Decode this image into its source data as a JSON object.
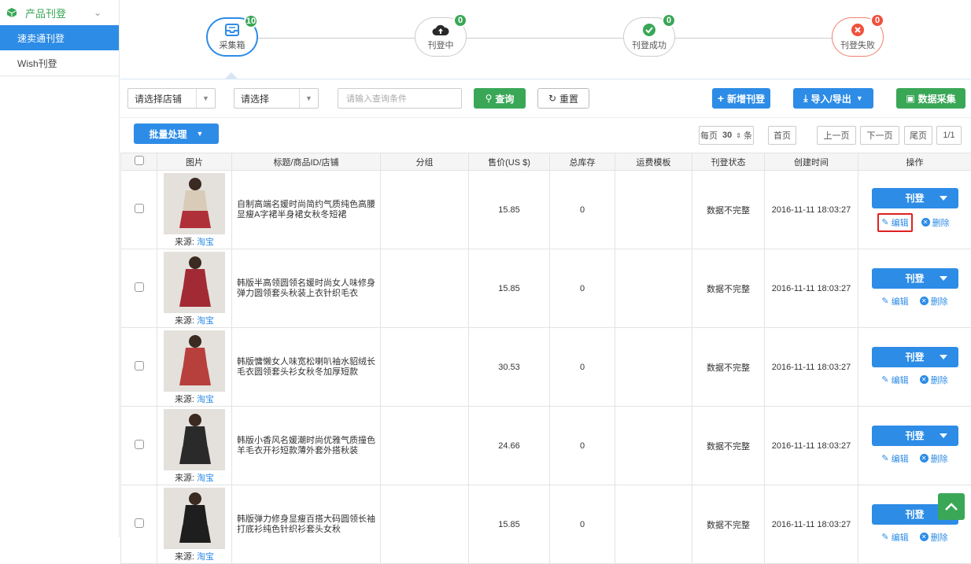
{
  "sidebar": {
    "header": "产品刊登",
    "items": [
      {
        "label": "速卖通刊登",
        "active": true
      },
      {
        "label": "Wish刊登",
        "active": false
      }
    ]
  },
  "steps": [
    {
      "label": "采集箱",
      "count": "10",
      "icon": "inbox-icon"
    },
    {
      "label": "刊登中",
      "count": "0",
      "icon": "cloud-upload-icon"
    },
    {
      "label": "刊登成功",
      "count": "0",
      "icon": "check-circle-icon"
    },
    {
      "label": "刊登失败",
      "count": "0",
      "icon": "x-circle-icon"
    }
  ],
  "filters": {
    "store_select": "请选择店铺",
    "field_select": "请选择",
    "query_placeholder": "请输入查询条件",
    "search_label": "查询",
    "reset_label": "重置",
    "add_label": "新增刊登",
    "import_label": "导入/导出",
    "collect_label": "数据采集"
  },
  "batch_label": "批量处理",
  "pagination": {
    "per_page_prefix": "每页",
    "per_page": "30",
    "per_page_suffix": "条",
    "first": "首页",
    "prev": "上一页",
    "next": "下一页",
    "last": "尾页",
    "page": "1/1"
  },
  "table": {
    "headers": [
      "",
      "图片",
      "标题/商品ID/店铺",
      "分组",
      "售价(US $)",
      "总库存",
      "运费模板",
      "刊登状态",
      "创建时间",
      "操作"
    ],
    "source_prefix": "来源:",
    "source_name": "淘宝",
    "publish_label": "刊登",
    "edit_label": "编辑",
    "delete_label": "删除",
    "rows": [
      {
        "title": "自制高端名媛时尚简约气质纯色高腰显瘦A字裙半身裙女秋冬短裙",
        "price": "15.85",
        "stock": "0",
        "status": "数据不完整",
        "created": "2016-11-11 18:03:27"
      },
      {
        "title": "韩版半高领圆领名媛时尚女人味修身弹力圆领套头秋装上衣针织毛衣",
        "price": "15.85",
        "stock": "0",
        "status": "数据不完整",
        "created": "2016-11-11 18:03:27"
      },
      {
        "title": "韩版慵懒女人味宽松喇叭袖水貂绒长毛衣圆领套头衫女秋冬加厚短款",
        "price": "30.53",
        "stock": "0",
        "status": "数据不完整",
        "created": "2016-11-11 18:03:27"
      },
      {
        "title": "韩版小香风名媛潮时尚优雅气质撞色羊毛衣开衫短款薄外套外搭秋装",
        "price": "24.66",
        "stock": "0",
        "status": "数据不完整",
        "created": "2016-11-11 18:03:27"
      },
      {
        "title": "韩版弹力修身显瘦百搭大码圆领长袖打底衫纯色针织衫套头女秋",
        "price": "15.85",
        "stock": "0",
        "status": "数据不完整",
        "created": "2016-11-11 18:03:27"
      }
    ]
  },
  "colors": {
    "accent": "#2d8ce6",
    "green": "#3aa757",
    "danger": "#f0503c"
  }
}
